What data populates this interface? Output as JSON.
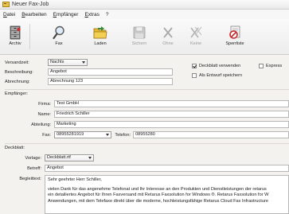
{
  "window": {
    "title": "Neuer Fax-Job"
  },
  "menu": {
    "items": [
      "Datei",
      "Bearbeiten",
      "Empfänger",
      "Extras",
      "?"
    ]
  },
  "toolbar": {
    "buttons": [
      {
        "label": "Archiv",
        "icon": "archive-icon",
        "disabled": false
      },
      {
        "label": "Fax",
        "icon": "magnifier-icon",
        "disabled": false
      },
      {
        "label": "Laden",
        "icon": "folder-icon",
        "disabled": false
      },
      {
        "label": "Sichern",
        "icon": "save-icon",
        "disabled": true
      },
      {
        "label": "Ohne",
        "icon": "x-icon",
        "disabled": true
      },
      {
        "label": "Keine",
        "icon": "x-multi-icon",
        "disabled": true
      },
      {
        "label": "Sperrliste",
        "icon": "blocklist-icon",
        "disabled": false
      }
    ]
  },
  "form": {
    "versandzeit_label": "Versandzeit:",
    "versandzeit_value": "Nachts",
    "beschreibung_label": "Beschreibung:",
    "beschreibung_value": "Angebot",
    "abrechnung_label": "Abrechnung:",
    "abrechnung_value": "Abrechnung 123",
    "deckblatt_verwenden_label": "Deckblatt verwenden",
    "deckblatt_verwenden_checked": true,
    "express_label": "Express",
    "express_checked": false,
    "entwurf_label": "Als Entwurf speichern",
    "entwurf_checked": false,
    "empfaenger_section": "Empfänger:",
    "firma_label": "Firma:",
    "firma_value": "Test GmbH",
    "name_label": "Name:",
    "name_value": "Friedrich Schiller",
    "abteilung_label": "Abteilung:",
    "abteilung_value": "Marketing",
    "fax_label": "Fax:",
    "fax_value": "08955281919",
    "telefon_label": "Telefon:",
    "telefon_value": "08955280",
    "deckblatt_section": "Deckblatt:",
    "vorlage_label": "Vorlage:",
    "vorlage_value": "Deckblatt.rtf",
    "betreff_label": "Betreff:",
    "betreff_value": "Angebot",
    "begleittext_label": "Begleittext:",
    "begleittext_lines": [
      "Sehr geehrter Herr Schiller,",
      "vielen Dank für das angenehme Telefonat und Ihr Interesse an den Produkten und Dienstleistungen der retarus",
      "ein detailiertes Angebot für Ihren Faxversand mit Retarus Faxsolution for Windows ®. Retarus Faxsolution for W",
      "Anwendungen, mit dem Telefaxe direkt über die moderne, hochleistungsfähige Retarus Cloud Fax Infrastructure"
    ]
  },
  "colors": {
    "accent": "#d9b93a",
    "blocklist_red": "#c8282c",
    "folder_yellow": "#e8b92c"
  }
}
